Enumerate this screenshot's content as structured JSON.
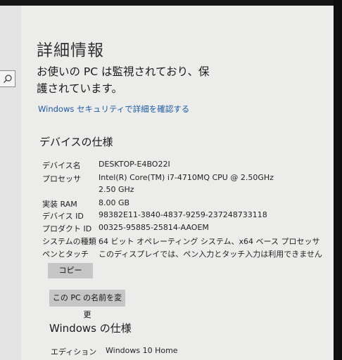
{
  "header": {
    "title": "詳細情報"
  },
  "status": {
    "protection_message": "お使いの PC は監視されており、保護されています。"
  },
  "links": {
    "security_details": "Windows セキュリティで詳細を確認する"
  },
  "device_specs": {
    "title": "デバイスの仕様",
    "rows": [
      {
        "label": "デバイス名",
        "value": "DESKTOP-E4BO22I"
      },
      {
        "label": "プロセッサ",
        "value": "Intel(R) Core(TM) i7-4710MQ CPU @ 2.50GHz   2.50 GHz"
      },
      {
        "label": "実装 RAM",
        "value": "8.00 GB"
      },
      {
        "label": "デバイス ID",
        "value": "98382E11-3840-4837-9259-237248733118"
      },
      {
        "label": "プロダクト ID",
        "value": "00325-95885-25814-AAOEM"
      },
      {
        "label": "システムの種類",
        "value": "64 ビット オペレーティング システム、x64 ベース プロセッサ"
      },
      {
        "label": "ペンとタッチ",
        "value": "このディスプレイでは、ペン入力とタッチ入力は利用できません"
      }
    ],
    "copy_button": "コピー",
    "rename_button": "この PC の名前を変更"
  },
  "windows_specs": {
    "title": "Windows の仕様",
    "rows": [
      {
        "label": "エディション",
        "value": "Windows 10 Home"
      }
    ]
  },
  "sidebar": {
    "search_icon": "search-icon"
  },
  "colors": {
    "link": "#1a5aa8",
    "background": "#ececea",
    "button": "#c6c6c6"
  }
}
